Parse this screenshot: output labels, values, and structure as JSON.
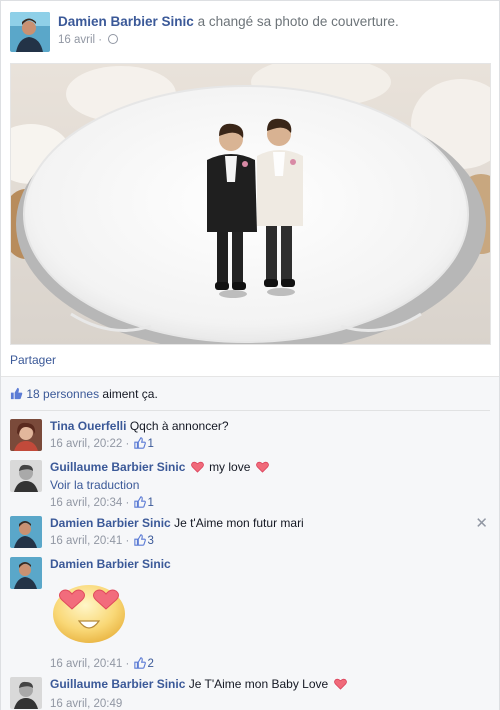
{
  "post": {
    "author": "Damien Barbier Sinic",
    "action": "a changé sa photo de couverture.",
    "date": "16 avril",
    "share_label": "Partager"
  },
  "likes": {
    "count_text": "18 personnes",
    "suffix": "aiment ça."
  },
  "comments": [
    {
      "author": "Tina Ouerfelli",
      "text": "Qqch à annoncer?",
      "time": "16 avril, 20:22",
      "likes": "1"
    },
    {
      "author": "Guillaume Barbier Sinic",
      "text": "my love",
      "translate": "Voir la traduction",
      "time": "16 avril, 20:34",
      "likes": "1"
    },
    {
      "author": "Damien Barbier Sinic",
      "text": "Je t'Aime mon futur mari",
      "time": "16 avril, 20:41",
      "likes": "3"
    },
    {
      "author": "Damien Barbier Sinic",
      "text": "",
      "time": "16 avril, 20:41",
      "likes": "2"
    },
    {
      "author": "Guillaume Barbier Sinic",
      "text": "Je T'Aime mon Baby Love",
      "time": "16 avril, 20:49"
    }
  ],
  "colors": {
    "link": "#3b5998",
    "muted": "#9197a3",
    "heart": "#e0245e",
    "feedback_bg": "#f6f7f9"
  },
  "icons": [
    "globe-icon",
    "thumbs-up-icon",
    "heart-icon",
    "close-icon",
    "heart-eyes-sticker"
  ]
}
